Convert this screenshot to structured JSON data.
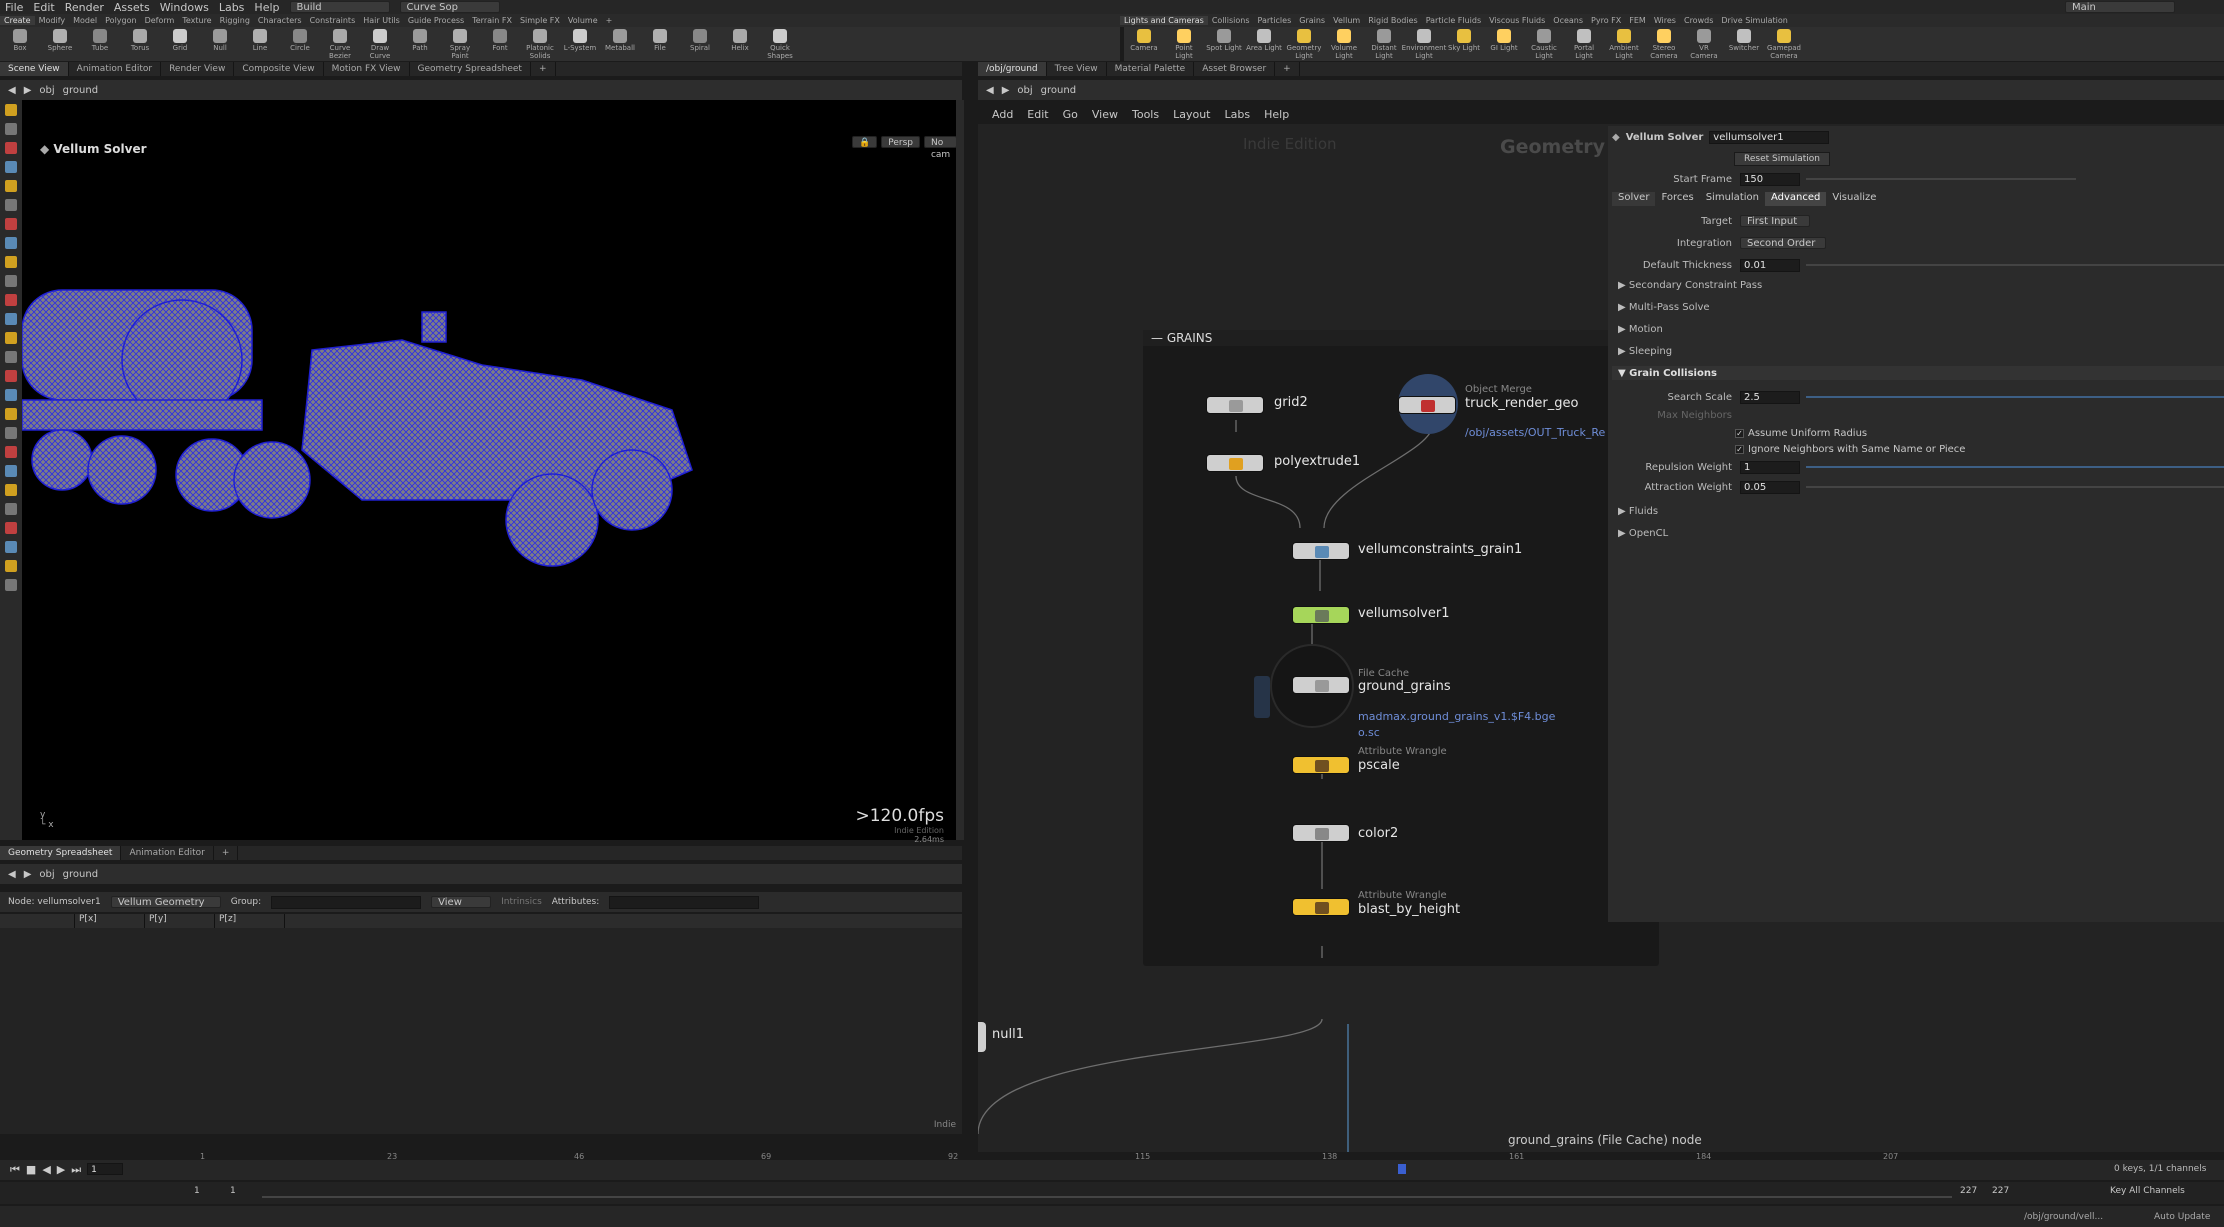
{
  "menu": {
    "items": [
      "File",
      "Edit",
      "Render",
      "Assets",
      "Windows",
      "Labs",
      "Help"
    ],
    "desktop": "Build",
    "context": "Curve Sop",
    "right": "Main"
  },
  "shelf_left": {
    "tabs": [
      "Create",
      "Modify",
      "Model",
      "Polygon",
      "Deform",
      "Texture",
      "Rigging",
      "Characters",
      "Constraints",
      "Hair Utils",
      "Guide Process",
      "Terrain FX",
      "Simple FX",
      "Volume"
    ],
    "tools": [
      "Box",
      "Sphere",
      "Tube",
      "Torus",
      "Grid",
      "Null",
      "Line",
      "Circle",
      "Curve Bezier",
      "Draw Curve",
      "Path",
      "Spray Paint",
      "Font",
      "Platonic Solids",
      "L-System",
      "Metaball",
      "File",
      "Spiral",
      "Helix",
      "Quick Shapes"
    ]
  },
  "shelf_right": {
    "tabs": [
      "Lights and Cameras",
      "Collisions",
      "Particles",
      "Grains",
      "Vellum",
      "Rigid Bodies",
      "Particle Fluids",
      "Viscous Fluids",
      "Oceans",
      "Pyro FX",
      "FEM",
      "Wires",
      "Crowds",
      "Drive Simulation"
    ],
    "tools": [
      "Camera",
      "Point Light",
      "Spot Light",
      "Area Light",
      "Geometry Light",
      "Volume Light",
      "Distant Light",
      "Environment Light",
      "Sky Light",
      "GI Light",
      "Caustic Light",
      "Portal Light",
      "Ambient Light",
      "Stereo Camera",
      "VR Camera",
      "Switcher",
      "Gamepad Camera"
    ]
  },
  "left_tabs": [
    "Scene View",
    "Animation Editor",
    "Render View",
    "Composite View",
    "Motion FX View",
    "Geometry Spreadsheet"
  ],
  "right_tabs": [
    "/obj/ground",
    "Tree View",
    "Material Palette",
    "Asset Browser"
  ],
  "path": {
    "obj": "obj",
    "node": "ground"
  },
  "viewport": {
    "title": "Vellum Solver",
    "persp": "Persp",
    "cam": "No cam",
    "fps": ">120.0fps",
    "fps_sub": "Indie Edition",
    "time": "2.64ms"
  },
  "network_menu": [
    "Add",
    "Edit",
    "Go",
    "View",
    "Tools",
    "Layout",
    "Labs",
    "Help"
  ],
  "network": {
    "watermark_left": "Indie Edition",
    "watermark_right": "Geometry",
    "box_title": "GRAINS",
    "nodes": {
      "grid": "grid2",
      "polyextrude": "polyextrude1",
      "objmerge_type": "Object Merge",
      "objmerge": "truck_render_geo",
      "objmerge_path": "/obj/assets/OUT_Truck_Render",
      "vc": "vellumconstraints_grain1",
      "vs": "vellumsolver1",
      "fc_type": "File Cache",
      "fc": "ground_grains",
      "fc_path1": "madmax.ground_grains_v1.$F4.bge",
      "fc_path2": "o.sc",
      "ps_type": "Attribute Wrangle",
      "ps": "pscale",
      "color": "color2",
      "bb_type": "Attribute Wrangle",
      "bb": "blast_by_height",
      "null": "null1"
    },
    "status": "ground_grains (File Cache) node"
  },
  "params": {
    "type": "Vellum Solver",
    "name": "vellumsolver1",
    "reset": "Reset Simulation",
    "start_frame_label": "Start Frame",
    "start_frame": "150",
    "tabs": [
      "Solver",
      "Forces",
      "Simulation",
      "Advanced",
      "Visualize"
    ],
    "target_label": "Target",
    "target": "First Input",
    "integration_label": "Integration",
    "integration": "Second Order",
    "thickness_label": "Default Thickness",
    "thickness": "0.01",
    "sections": [
      "Secondary Constraint Pass",
      "Multi-Pass Solve",
      "Motion",
      "Sleeping"
    ],
    "grain_section": "Grain Collisions",
    "search_label": "Search Scale",
    "search": "2.5",
    "maxn_label": "Max Neighbors",
    "uniform": "Assume Uniform Radius",
    "ignore": "Ignore Neighbors with Same Name or Piece",
    "rep_label": "Repulsion Weight",
    "rep": "1",
    "att_label": "Attraction Weight",
    "att": "0.05",
    "after": [
      "Fluids",
      "OpenCL"
    ]
  },
  "spreadsheet": {
    "tabs": [
      "Geometry Spreadsheet",
      "Animation Editor"
    ],
    "node_label": "Node: vellumsolver1",
    "geo": "Vellum Geometry",
    "group": "Group:",
    "view": "View",
    "intrinsics": "Intrinsics",
    "attributes": "Attributes:",
    "cols": [
      "",
      "P[x]",
      "P[y]",
      "P[z]"
    ],
    "footer": "Indie"
  },
  "timeline": {
    "frame": "1",
    "start": "1",
    "start2": "1",
    "end": "227",
    "end2": "227",
    "ticks": [
      "1",
      "23",
      "46",
      "69",
      "92",
      "115",
      "138",
      "161",
      "184",
      "207"
    ],
    "keys": "0 keys, 1/1 channels",
    "keyall": "Key All Channels",
    "path": "/obj/ground/vell...",
    "auto": "Auto Update"
  }
}
